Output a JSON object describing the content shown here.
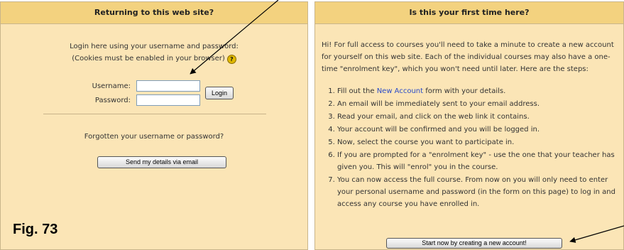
{
  "returning": {
    "title": "Returning to this web site?",
    "intro_line1": "Login here using your username and password:",
    "intro_line2": "(Cookies must be enabled in your browser)",
    "help_icon": "?",
    "username_label": "Username:",
    "password_label": "Password:",
    "username_value": "",
    "password_value": "",
    "login_button": "Login",
    "forgot_text": "Forgotten your username or password?",
    "send_button": "Send my details via email"
  },
  "first_time": {
    "title": "Is this your first time here?",
    "intro": "Hi! For full access to courses you'll need to take a minute to create a new account for yourself on this web site. Each of the individual courses may also have a one-time \"enrolment key\", which you won't need until later. Here are the steps:",
    "step1_before": "Fill out the ",
    "step1_link": "New Account",
    "step1_after": " form with your details.",
    "steps": [
      "An email will be immediately sent to your email address.",
      "Read your email, and click on the web link it contains.",
      "Your account will be confirmed and you will be logged in.",
      "Now, select the course you want to participate in.",
      "If you are prompted for a \"enrolment key\" - use the one that your teacher has given you. This will \"enrol\" you in the course.",
      "You can now access the full course. From now on you will only need to enter your personal username and password (in the form on this page) to log in and access any course you have enrolled in."
    ],
    "create_button": "Start now by creating a new account!"
  },
  "figure_label": "Fig. 73",
  "colors": {
    "panel_bg": "#fbe5b6",
    "header_bg": "#f3d27f",
    "link": "#2a4bc8"
  }
}
